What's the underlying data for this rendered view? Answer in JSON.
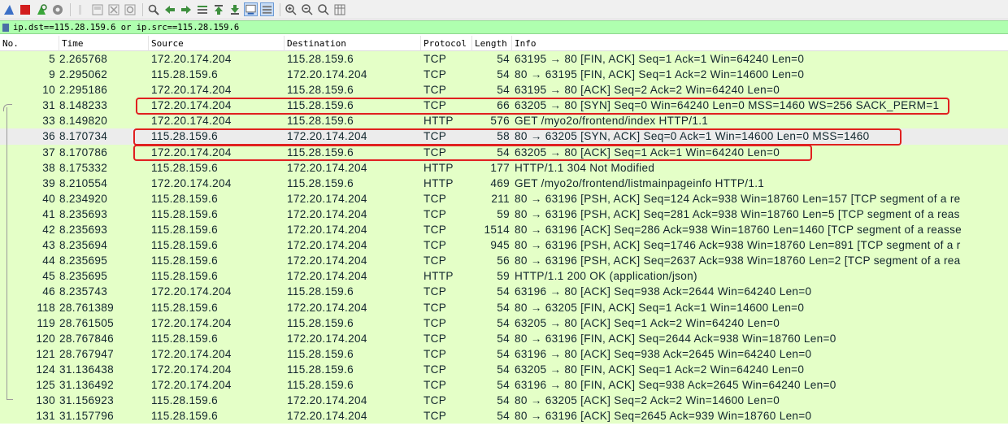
{
  "toolbar": {
    "icons": [
      "shark-fin-icon",
      "stop-icon",
      "restart-icon",
      "capture-options-icon",
      "open-file-icon",
      "save-file-icon",
      "close-file-icon",
      "reload-icon",
      "find-icon",
      "go-back-icon",
      "go-forward-icon",
      "go-to-packet-icon",
      "first-packet-icon",
      "last-packet-icon",
      "autoscroll-icon",
      "colorize-icon",
      "zoom-in-icon",
      "zoom-out-icon",
      "normal-size-icon",
      "resize-columns-icon"
    ]
  },
  "filter": {
    "text": "ip.dst==115.28.159.6 or ip.src==115.28.159.6"
  },
  "columns": {
    "no": "No.",
    "time": "Time",
    "source": "Source",
    "destination": "Destination",
    "protocol": "Protocol",
    "length": "Length",
    "info": "Info"
  },
  "packets": [
    {
      "no": "5",
      "time": "2.265768",
      "src": "172.20.174.204",
      "dst": "115.28.159.6",
      "proto": "TCP",
      "len": "54",
      "info": "63195 → 80 [FIN, ACK] Seq=1 Ack=1 Win=64240 Len=0"
    },
    {
      "no": "9",
      "time": "2.295062",
      "src": "115.28.159.6",
      "dst": "172.20.174.204",
      "proto": "TCP",
      "len": "54",
      "info": "80 → 63195 [FIN, ACK] Seq=1 Ack=2 Win=14600 Len=0"
    },
    {
      "no": "10",
      "time": "2.295186",
      "src": "172.20.174.204",
      "dst": "115.28.159.6",
      "proto": "TCP",
      "len": "54",
      "info": "63195 → 80 [ACK] Seq=2 Ack=2 Win=64240 Len=0"
    },
    {
      "no": "31",
      "time": "8.148233",
      "src": "172.20.174.204",
      "dst": "115.28.159.6",
      "proto": "TCP",
      "len": "66",
      "info": "63205 → 80 [SYN] Seq=0 Win=64240 Len=0 MSS=1460 WS=256 SACK_PERM=1"
    },
    {
      "no": "33",
      "time": "8.149820",
      "src": "172.20.174.204",
      "dst": "115.28.159.6",
      "proto": "HTTP",
      "len": "576",
      "info": "GET /myo2o/frontend/index HTTP/1.1"
    },
    {
      "no": "36",
      "time": "8.170734",
      "src": "115.28.159.6",
      "dst": "172.20.174.204",
      "proto": "TCP",
      "len": "58",
      "info": "80 → 63205 [SYN, ACK] Seq=0 Ack=1 Win=14600 Len=0 MSS=1460"
    },
    {
      "no": "37",
      "time": "8.170786",
      "src": "172.20.174.204",
      "dst": "115.28.159.6",
      "proto": "TCP",
      "len": "54",
      "info": "63205 → 80 [ACK] Seq=1 Ack=1 Win=64240 Len=0"
    },
    {
      "no": "38",
      "time": "8.175332",
      "src": "115.28.159.6",
      "dst": "172.20.174.204",
      "proto": "HTTP",
      "len": "177",
      "info": "HTTP/1.1 304 Not Modified"
    },
    {
      "no": "39",
      "time": "8.210554",
      "src": "172.20.174.204",
      "dst": "115.28.159.6",
      "proto": "HTTP",
      "len": "469",
      "info": "GET /myo2o/frontend/listmainpageinfo HTTP/1.1"
    },
    {
      "no": "40",
      "time": "8.234920",
      "src": "115.28.159.6",
      "dst": "172.20.174.204",
      "proto": "TCP",
      "len": "211",
      "info": "80 → 63196 [PSH, ACK] Seq=124 Ack=938 Win=18760 Len=157 [TCP segment of a re"
    },
    {
      "no": "41",
      "time": "8.235693",
      "src": "115.28.159.6",
      "dst": "172.20.174.204",
      "proto": "TCP",
      "len": "59",
      "info": "80 → 63196 [PSH, ACK] Seq=281 Ack=938 Win=18760 Len=5 [TCP segment of a reas"
    },
    {
      "no": "42",
      "time": "8.235693",
      "src": "115.28.159.6",
      "dst": "172.20.174.204",
      "proto": "TCP",
      "len": "1514",
      "info": "80 → 63196 [ACK] Seq=286 Ack=938 Win=18760 Len=1460 [TCP segment of a reasse"
    },
    {
      "no": "43",
      "time": "8.235694",
      "src": "115.28.159.6",
      "dst": "172.20.174.204",
      "proto": "TCP",
      "len": "945",
      "info": "80 → 63196 [PSH, ACK] Seq=1746 Ack=938 Win=18760 Len=891 [TCP segment of a r"
    },
    {
      "no": "44",
      "time": "8.235695",
      "src": "115.28.159.6",
      "dst": "172.20.174.204",
      "proto": "TCP",
      "len": "56",
      "info": "80 → 63196 [PSH, ACK] Seq=2637 Ack=938 Win=18760 Len=2 [TCP segment of a rea"
    },
    {
      "no": "45",
      "time": "8.235695",
      "src": "115.28.159.6",
      "dst": "172.20.174.204",
      "proto": "HTTP",
      "len": "59",
      "info": "HTTP/1.1 200 OK  (application/json)"
    },
    {
      "no": "46",
      "time": "8.235743",
      "src": "172.20.174.204",
      "dst": "115.28.159.6",
      "proto": "TCP",
      "len": "54",
      "info": "63196 → 80 [ACK] Seq=938 Ack=2644 Win=64240 Len=0"
    },
    {
      "no": "118",
      "time": "28.761389",
      "src": "115.28.159.6",
      "dst": "172.20.174.204",
      "proto": "TCP",
      "len": "54",
      "info": "80 → 63205 [FIN, ACK] Seq=1 Ack=1 Win=14600 Len=0"
    },
    {
      "no": "119",
      "time": "28.761505",
      "src": "172.20.174.204",
      "dst": "115.28.159.6",
      "proto": "TCP",
      "len": "54",
      "info": "63205 → 80 [ACK] Seq=1 Ack=2 Win=64240 Len=0"
    },
    {
      "no": "120",
      "time": "28.767846",
      "src": "115.28.159.6",
      "dst": "172.20.174.204",
      "proto": "TCP",
      "len": "54",
      "info": "80 → 63196 [FIN, ACK] Seq=2644 Ack=938 Win=18760 Len=0"
    },
    {
      "no": "121",
      "time": "28.767947",
      "src": "172.20.174.204",
      "dst": "115.28.159.6",
      "proto": "TCP",
      "len": "54",
      "info": "63196 → 80 [ACK] Seq=938 Ack=2645 Win=64240 Len=0"
    },
    {
      "no": "124",
      "time": "31.136438",
      "src": "172.20.174.204",
      "dst": "115.28.159.6",
      "proto": "TCP",
      "len": "54",
      "info": "63205 → 80 [FIN, ACK] Seq=1 Ack=2 Win=64240 Len=0"
    },
    {
      "no": "125",
      "time": "31.136492",
      "src": "172.20.174.204",
      "dst": "115.28.159.6",
      "proto": "TCP",
      "len": "54",
      "info": "63196 → 80 [FIN, ACK] Seq=938 Ack=2645 Win=64240 Len=0"
    },
    {
      "no": "130",
      "time": "31.156923",
      "src": "115.28.159.6",
      "dst": "172.20.174.204",
      "proto": "TCP",
      "len": "54",
      "info": "80 → 63205 [ACK] Seq=2 Ack=2 Win=14600 Len=0"
    },
    {
      "no": "131",
      "time": "31.157796",
      "src": "115.28.159.6",
      "dst": "172.20.174.204",
      "proto": "TCP",
      "len": "54",
      "info": "80 → 63196 [ACK] Seq=2645 Ack=939 Win=18760 Len=0"
    }
  ],
  "colors": {
    "row_bg": "#e4ffc7",
    "selected_row_bg": "#ececec",
    "highlight_border": "#e02020",
    "filter_bg": "#afffaf"
  }
}
